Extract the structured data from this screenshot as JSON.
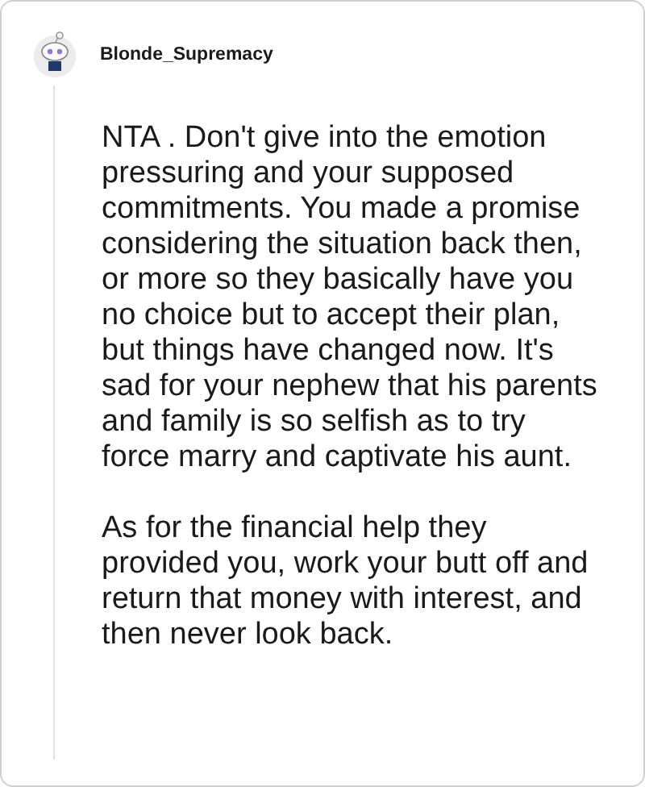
{
  "comment": {
    "author": "Blonde_Supremacy",
    "paragraphs": [
      "NTA . Don't give into the emotion pressuring and your supposed commitments. You made a promise considering the situation back then, or more so they basically have you no choice but to accept their plan, but things have changed now. It's sad for your nephew that his parents and family is so selfish as to try force marry and captivate his aunt.",
      "As for the financial help they provided you, work your butt off and return that money with interest, and then never look back."
    ]
  }
}
